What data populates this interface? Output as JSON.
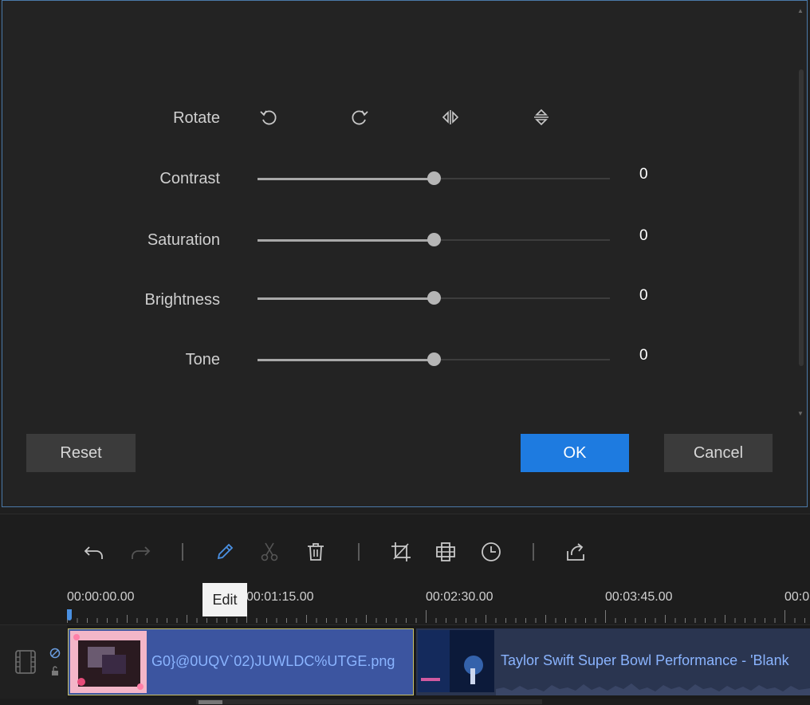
{
  "dialog": {
    "rotate_label": "Rotate",
    "rotate_buttons": [
      "rotate-left",
      "rotate-right",
      "flip-horizontal",
      "flip-vertical"
    ],
    "sliders": [
      {
        "label": "Contrast",
        "value": "0",
        "level": 0.5
      },
      {
        "label": "Saturation",
        "value": "0",
        "level": 0.5
      },
      {
        "label": "Brightness",
        "value": "0",
        "level": 0.5
      },
      {
        "label": "Tone",
        "value": "0",
        "level": 0.5
      }
    ],
    "reset_label": "Reset",
    "ok_label": "OK",
    "cancel_label": "Cancel",
    "accent_color": "#1e7be0"
  },
  "toolbar": {
    "icons": [
      "undo-icon",
      "redo-icon",
      "edit-icon",
      "cut-icon",
      "delete-icon",
      "crop-icon",
      "mosaic-icon",
      "speed-icon",
      "export-icon"
    ],
    "tooltip": "Edit"
  },
  "timeline": {
    "times": [
      "00:00:00.00",
      "00:01:15.00",
      "00:02:30.00",
      "00:03:45.00",
      "00:0"
    ],
    "clips": [
      {
        "name": "G0}@0UQV`02)JUWLDC%UTGE.png"
      },
      {
        "name": "Taylor Swift Super Bowl Performance - 'Blank"
      }
    ]
  }
}
